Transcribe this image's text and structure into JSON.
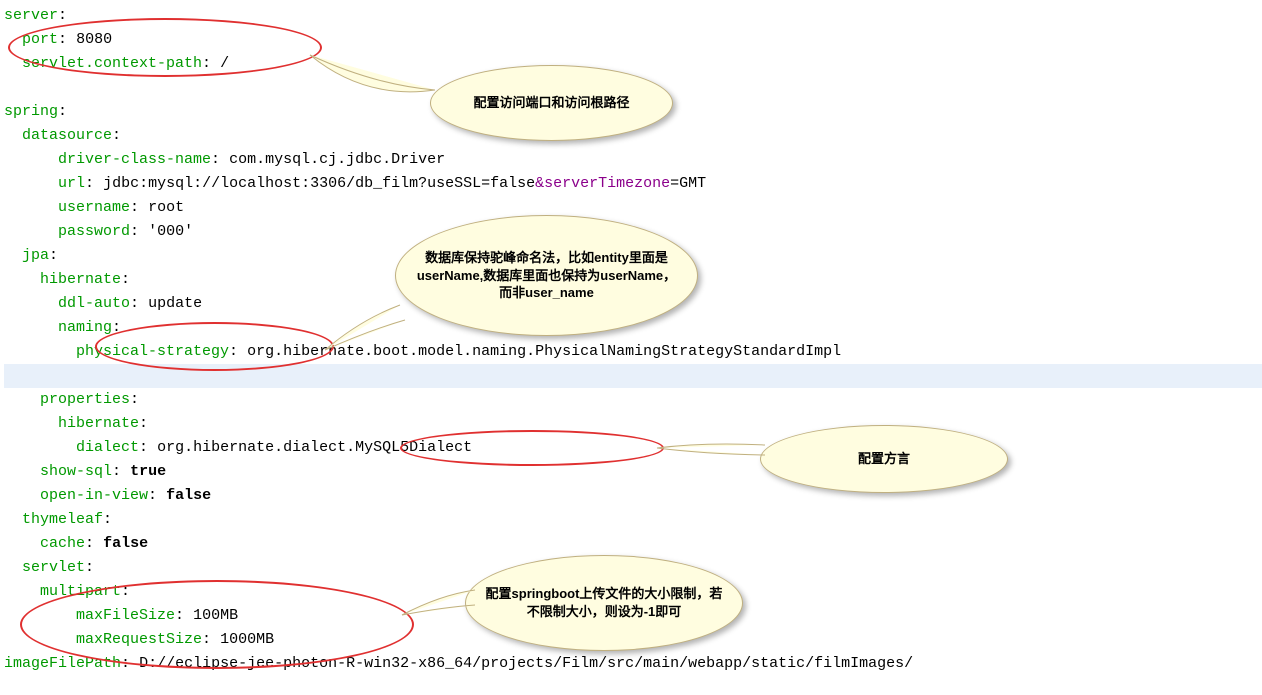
{
  "lines": {
    "l1_key": "server",
    "l2_key": "port",
    "l2_val": "8080",
    "l3_key": "servlet.context-path",
    "l3_val": "/",
    "l4_key": "spring",
    "l5_key": "datasource",
    "l6_key": "driver-class-name",
    "l6_val": "com.mysql.cj.jdbc.Driver",
    "l7_key": "url",
    "l7_val_a": "jdbc:mysql://localhost:3306/db_film?useSSL=false",
    "l7_val_b": "&serverTimezone",
    "l7_val_c": "=GMT",
    "l8_key": "username",
    "l8_val": "root",
    "l9_key": "password",
    "l9_val": "'000'",
    "l10_key": "jpa",
    "l11_key": "hibernate",
    "l12_key": "ddl-auto",
    "l12_val": "update",
    "l13_key": "naming",
    "l14_key": "physical-strategy",
    "l14_val": "org.hibernate.boot.model.naming.PhysicalNamingStrategyStandardImpl",
    "l15_key": "properties",
    "l16_key": "hibernate",
    "l17_key": "dialect",
    "l17_val": "org.hibernate.dialect.MySQL5Dialect",
    "l18_key": "show-sql",
    "l18_val": "true",
    "l19_key": "open-in-view",
    "l19_val": "false",
    "l20_key": "thymeleaf",
    "l21_key": "cache",
    "l21_val": "false",
    "l22_key": "servlet",
    "l23_key": "multipart",
    "l24_key": "maxFileSize",
    "l24_val": "100MB",
    "l25_key": "maxRequestSize",
    "l25_val": "1000MB",
    "l26_key": "imageFilePath",
    "l26_val": "D://eclipse-jee-photon-R-win32-x86_64/projects/Film/src/main/webapp/static/filmImages/"
  },
  "callouts": {
    "c1": "配置访问端口和访问根路径",
    "c2": "数据库保持驼峰命名法，比如entity里面是userName,数据库里面也保持为userName，而非user_name",
    "c3": "配置方言",
    "c4": "配置springboot上传文件的大小限制，若不限制大小，则设为-1即可"
  }
}
